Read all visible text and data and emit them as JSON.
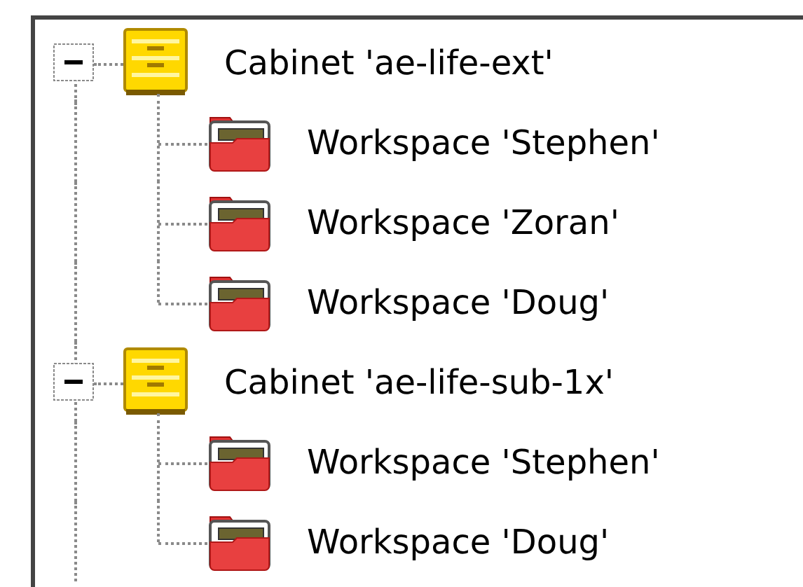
{
  "tree": [
    {
      "label": "Cabinet 'ae-life-ext'",
      "expanded": true,
      "children": [
        {
          "label": "Workspace 'Stephen'"
        },
        {
          "label": "Workspace 'Zoran'"
        },
        {
          "label": "Workspace 'Doug'"
        }
      ]
    },
    {
      "label": "Cabinet 'ae-life-sub-1x'",
      "expanded": true,
      "children": [
        {
          "label": "Workspace 'Stephen'"
        },
        {
          "label": "Workspace 'Doug'"
        }
      ]
    }
  ]
}
